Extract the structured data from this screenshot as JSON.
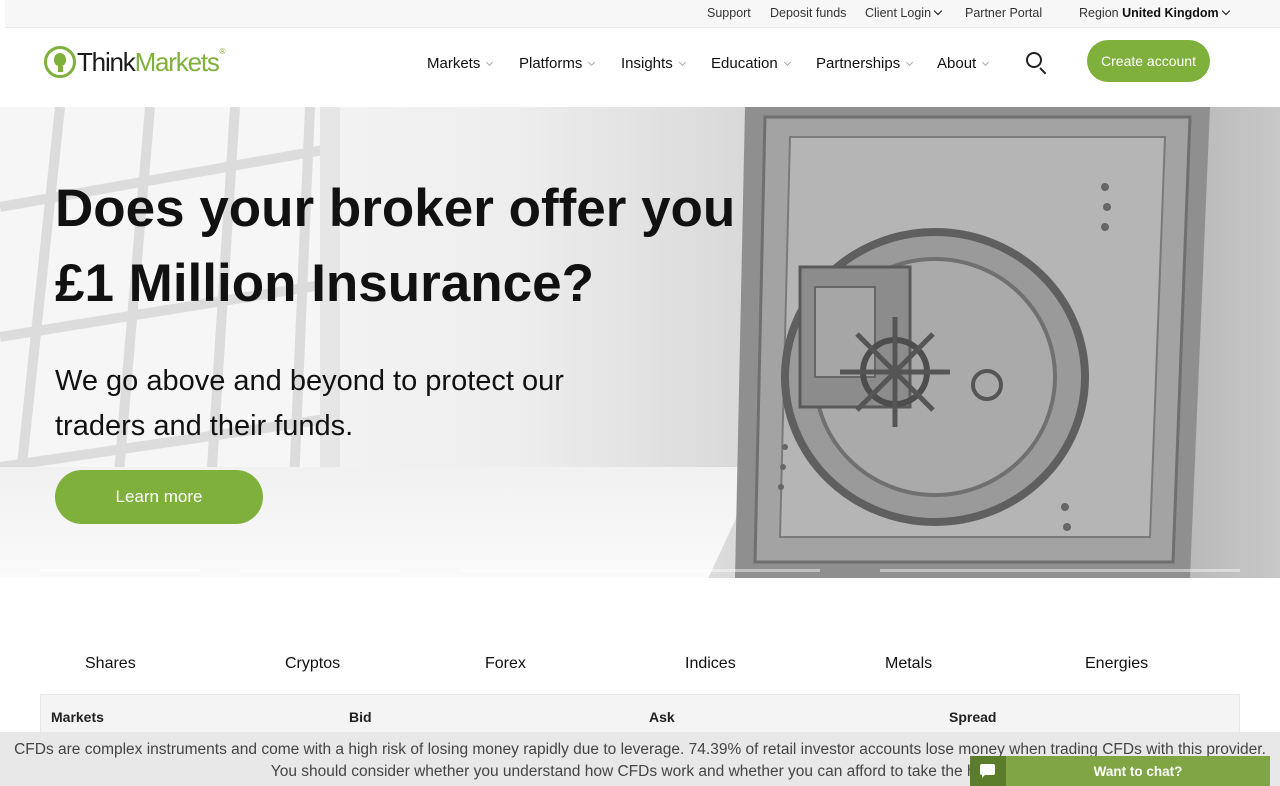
{
  "topbar": {
    "support": "Support",
    "deposit": "Deposit funds",
    "client_login": "Client Login",
    "partner_portal": "Partner Portal",
    "region_label": "Region",
    "region_value": "United Kingdom"
  },
  "header": {
    "logo_think": "Think",
    "logo_markets": "Markets",
    "logo_reg": "®",
    "nav": [
      {
        "label": "Markets"
      },
      {
        "label": "Platforms"
      },
      {
        "label": "Insights"
      },
      {
        "label": "Education"
      },
      {
        "label": "Partnerships"
      },
      {
        "label": "About"
      }
    ],
    "search_icon": "search-icon",
    "create_account": "Create account"
  },
  "hero": {
    "title": "Does your broker offer you £1 Million Insurance?",
    "subtitle": "We go above and beyond to protect our traders and their funds.",
    "cta": "Learn more"
  },
  "markets": {
    "tabs": [
      "Shares",
      "Cryptos",
      "Forex",
      "Indices",
      "Metals",
      "Energies"
    ],
    "columns": [
      "Markets",
      "Bid",
      "Ask",
      "Spread"
    ]
  },
  "risk_warning": {
    "text": "CFDs are complex instruments and come with a high risk of losing money rapidly due to leverage. 74.39% of retail investor accounts lose money when trading CFDs with this provider. You should consider whether you understand how CFDs work and whether you can afford to take the high ri"
  },
  "chat": {
    "icon": "chat-bubble-icon",
    "label": "Want to chat?"
  },
  "colors": {
    "brand_green": "#7fb03b",
    "chat_green": "#7fa643"
  }
}
